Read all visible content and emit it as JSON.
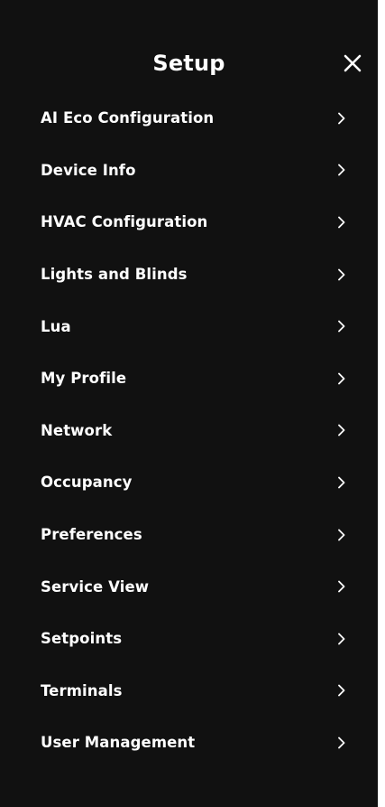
{
  "header": {
    "title": "Setup",
    "close_icon": "close-icon"
  },
  "menu": {
    "items": [
      {
        "label": "AI Eco Configuration",
        "icon": "chevron-right-icon"
      },
      {
        "label": "Device Info",
        "icon": "chevron-right-icon"
      },
      {
        "label": "HVAC Configuration",
        "icon": "chevron-right-icon"
      },
      {
        "label": "Lights and Blinds",
        "icon": "chevron-right-icon"
      },
      {
        "label": "Lua",
        "icon": "chevron-right-icon"
      },
      {
        "label": "My Profile",
        "icon": "chevron-right-icon"
      },
      {
        "label": "Network",
        "icon": "chevron-right-icon"
      },
      {
        "label": "Occupancy",
        "icon": "chevron-right-icon"
      },
      {
        "label": "Preferences",
        "icon": "chevron-right-icon"
      },
      {
        "label": "Service View",
        "icon": "chevron-right-icon"
      },
      {
        "label": "Setpoints",
        "icon": "chevron-right-icon"
      },
      {
        "label": "Terminals",
        "icon": "chevron-right-icon"
      },
      {
        "label": "User Management",
        "icon": "chevron-right-icon"
      }
    ]
  },
  "colors": {
    "background": "#111111",
    "text": "#ffffff"
  }
}
